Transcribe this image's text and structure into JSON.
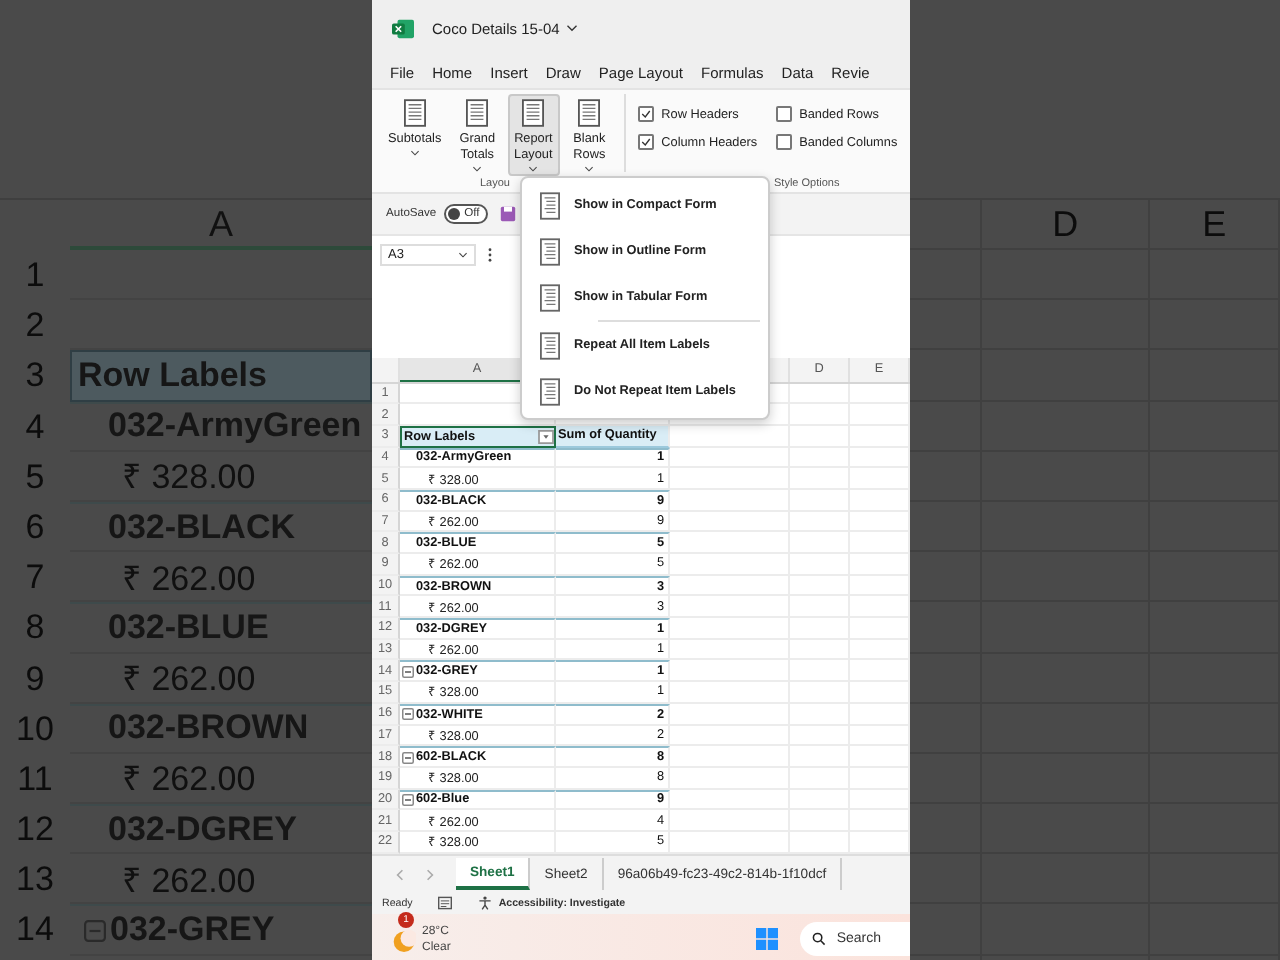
{
  "window": {
    "title": "Coco Details 15-04"
  },
  "menu_tabs": [
    "File",
    "Home",
    "Insert",
    "Draw",
    "Page Layout",
    "Formulas",
    "Data",
    "Revie"
  ],
  "ribbon": {
    "buttons": [
      {
        "lines": [
          "Subtotals"
        ],
        "pressed": false
      },
      {
        "lines": [
          "Grand",
          "Totals"
        ],
        "pressed": false
      },
      {
        "lines": [
          "Report",
          "Layout"
        ],
        "pressed": true
      },
      {
        "lines": [
          "Blank",
          "Rows"
        ],
        "pressed": false
      }
    ],
    "checkboxes": [
      {
        "label": "Row Headers",
        "checked": true
      },
      {
        "label": "Column Headers",
        "checked": true
      },
      {
        "label": "Banded Rows",
        "checked": false
      },
      {
        "label": "Banded Columns",
        "checked": false
      }
    ],
    "group_labels": [
      "Layou",
      "Style Options"
    ]
  },
  "autosave": {
    "label": "AutoSave",
    "state": "Off",
    "on": false
  },
  "name_box": "A3",
  "layout_menu": {
    "groups": [
      [
        {
          "label": "Show in Compact Form"
        },
        {
          "label": "Show in Outline Form"
        },
        {
          "label": "Show in Tabular Form"
        }
      ],
      [
        {
          "label": "Repeat All Item Labels"
        },
        {
          "label": "Do Not Repeat Item Labels"
        }
      ]
    ]
  },
  "column_headers": [
    "A",
    "D",
    "E"
  ],
  "empty_rows": [
    "1",
    "2"
  ],
  "pivot": {
    "header": {
      "row": "3",
      "row_labels": "Row Labels",
      "value_header": "Sum of Quantity"
    },
    "items": [
      {
        "row": "4",
        "label": "032-ArmyGreen",
        "value": "1",
        "collapse_button": false,
        "children": [
          {
            "row": "5",
            "label": "₹ 328.00",
            "value": "1"
          }
        ]
      },
      {
        "row": "6",
        "label": "032-BLACK",
        "value": "9",
        "collapse_button": false,
        "children": [
          {
            "row": "7",
            "label": "₹ 262.00",
            "value": "9"
          }
        ]
      },
      {
        "row": "8",
        "label": "032-BLUE",
        "value": "5",
        "collapse_button": false,
        "children": [
          {
            "row": "9",
            "label": "₹ 262.00",
            "value": "5"
          }
        ]
      },
      {
        "row": "10",
        "label": "032-BROWN",
        "value": "3",
        "collapse_button": false,
        "children": [
          {
            "row": "11",
            "label": "₹ 262.00",
            "value": "3"
          }
        ]
      },
      {
        "row": "12",
        "label": "032-DGREY",
        "value": "1",
        "collapse_button": false,
        "children": [
          {
            "row": "13",
            "label": "₹ 262.00",
            "value": "1"
          }
        ]
      },
      {
        "row": "14",
        "label": "032-GREY",
        "value": "1",
        "collapse_button": true,
        "children": [
          {
            "row": "15",
            "label": "₹ 328.00",
            "value": "1"
          }
        ]
      },
      {
        "row": "16",
        "label": "032-WHITE",
        "value": "2",
        "collapse_button": true,
        "children": [
          {
            "row": "17",
            "label": "₹ 328.00",
            "value": "2"
          }
        ]
      },
      {
        "row": "18",
        "label": "602-BLACK",
        "value": "8",
        "collapse_button": true,
        "children": [
          {
            "row": "19",
            "label": "₹ 328.00",
            "value": "8"
          }
        ]
      },
      {
        "row": "20",
        "label": "602-Blue",
        "value": "9",
        "collapse_button": true,
        "children": [
          {
            "row": "21",
            "label": "₹ 262.00",
            "value": "4"
          },
          {
            "row": "22",
            "label": "₹ 328.00",
            "value": "5"
          }
        ]
      }
    ]
  },
  "sheet_tabs": [
    {
      "label": "Sheet1",
      "selected": true
    },
    {
      "label": "Sheet2",
      "selected": false
    },
    {
      "label": "96a06b49-fc23-49c2-814b-1f10dcf",
      "selected": false
    }
  ],
  "status_bar": {
    "ready": "Ready",
    "accessibility": "Accessibility: Investigate"
  },
  "taskbar": {
    "weather": {
      "badge": "1",
      "temperature": "28°C",
      "condition": "Clear"
    },
    "search": "Search"
  },
  "background": {
    "left": {
      "column_header": "A",
      "rows": [
        {
          "row": "1",
          "kind": "empty"
        },
        {
          "row": "2",
          "kind": "empty"
        },
        {
          "row": "3",
          "kind": "header",
          "label": "Row Labels"
        },
        {
          "row": "4",
          "kind": "item",
          "label": "032-ArmyGreen",
          "collapse_button": false
        },
        {
          "row": "5",
          "kind": "price",
          "label": "₹ 328.00"
        },
        {
          "row": "6",
          "kind": "item",
          "label": "032-BLACK",
          "collapse_button": false
        },
        {
          "row": "7",
          "kind": "price",
          "label": "₹ 262.00"
        },
        {
          "row": "8",
          "kind": "item",
          "label": "032-BLUE",
          "collapse_button": false
        },
        {
          "row": "9",
          "kind": "price",
          "label": "₹ 262.00"
        },
        {
          "row": "10",
          "kind": "item",
          "label": "032-BROWN",
          "collapse_button": false
        },
        {
          "row": "11",
          "kind": "price",
          "label": "₹ 262.00"
        },
        {
          "row": "12",
          "kind": "item",
          "label": "032-DGREY",
          "collapse_button": false
        },
        {
          "row": "13",
          "kind": "price",
          "label": "₹ 262.00"
        },
        {
          "row": "14",
          "kind": "item",
          "label": "032-GREY",
          "collapse_button": true
        }
      ]
    },
    "right": {
      "column_headers": [
        "D",
        "E"
      ]
    }
  }
}
